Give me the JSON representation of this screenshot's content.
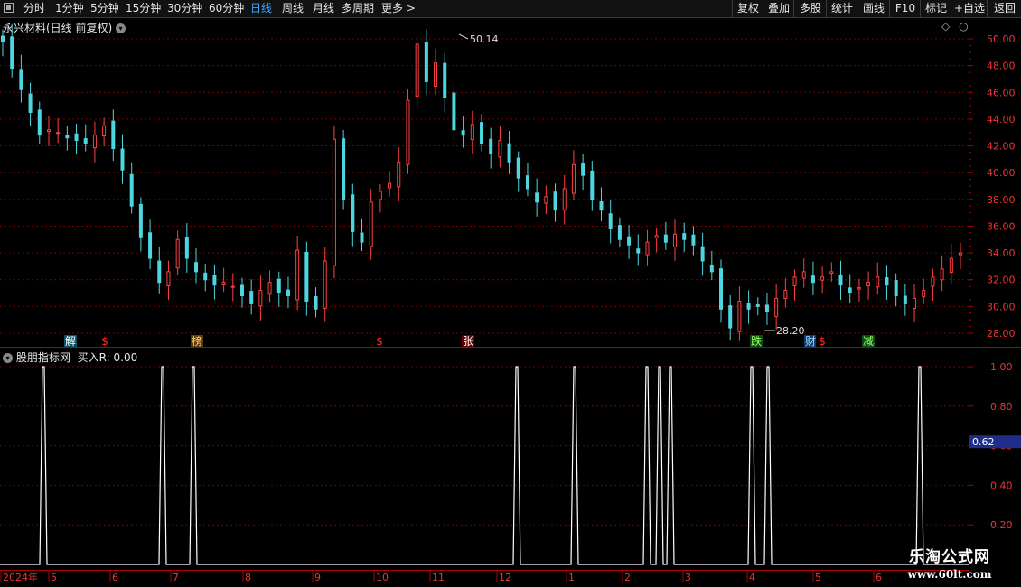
{
  "toolbar": {
    "periods": [
      "分时",
      "1分钟",
      "5分钟",
      "15分钟",
      "30分钟",
      "60分钟",
      "日线",
      "周线",
      "月线",
      "多周期",
      "更多 >"
    ],
    "active_period": "日线",
    "right_buttons": [
      "复权",
      "叠加",
      "多股",
      "统计",
      "画线",
      "F10",
      "标记",
      "+自选",
      "返回"
    ]
  },
  "main_panel": {
    "title": "永兴材料(日线 前复权)",
    "price_axis": [
      "50.00",
      "48.00",
      "46.00",
      "44.00",
      "42.00",
      "40.00",
      "38.00",
      "36.00",
      "34.00",
      "32.00",
      "30.00",
      "28.00"
    ],
    "high_label": "50.14",
    "low_label": "28.20",
    "event_markers": [
      "解",
      "$",
      "榜",
      "$",
      "张",
      "跌",
      "财",
      "$",
      "减"
    ]
  },
  "indicator_panel": {
    "title": "股朋指标网",
    "indicator_label": "买入R: 0.00",
    "axis": [
      "1.00",
      "0.80",
      "0.60",
      "0.40",
      "0.20"
    ],
    "current_value": "0.62",
    "spike_positions": [
      "2024-05-07",
      "2024-06-19",
      "2024-07-03",
      "2024-11-26",
      "2024-12-10",
      "2025-02-14",
      "2025-02-18",
      "2025-02-21",
      "2025-03-31",
      "2025-04-08",
      "2025-05-27"
    ]
  },
  "chart_data": {
    "type": "candlestick",
    "title": "永兴材料(日线 前复权)",
    "y_range": [
      27.5,
      51.0
    ],
    "y_ticks": [
      28,
      30,
      32,
      34,
      36,
      38,
      40,
      42,
      44,
      46,
      48,
      50
    ],
    "time_labels": [
      "2024年",
      "5",
      "6",
      "7",
      "8",
      "9",
      "10",
      "11",
      "12",
      "1",
      "2",
      "3",
      "4",
      "5",
      "6"
    ],
    "series": [
      {
        "name": "close",
        "values": [
          49.8,
          47.8,
          46.2,
          44.5,
          42.8,
          43.2,
          43.0,
          42.6,
          42.4,
          42.2,
          42.8,
          43.5,
          41.8,
          40.2,
          37.5,
          35.2,
          33.6,
          31.8,
          32.6,
          35.0,
          33.6,
          32.6,
          32.0,
          31.6,
          31.8,
          31.5,
          30.8,
          30.2,
          31.2,
          31.8,
          31.0,
          30.8,
          34.2,
          30.4,
          29.8,
          33.4,
          42.5,
          38.0,
          35.6,
          34.8,
          37.8,
          38.6,
          39.2,
          40.8,
          45.4,
          49.6,
          46.8,
          48.2,
          45.6,
          43.2,
          42.8,
          43.6,
          42.2,
          41.4,
          42.4,
          40.8,
          39.6,
          38.8,
          37.8,
          38.2,
          37.2,
          38.8,
          40.6,
          39.8,
          38.0,
          37.2,
          35.8,
          35.0,
          34.6,
          34.0,
          34.8,
          35.3,
          34.8,
          35.4,
          35.0,
          34.6,
          33.4,
          32.6,
          29.8,
          28.4,
          30.4,
          29.8,
          30.0,
          29.6,
          30.6,
          31.2,
          32.2,
          32.6,
          31.8,
          32.2,
          32.6,
          31.6,
          31.0,
          31.4,
          31.8,
          32.2,
          31.6,
          30.8,
          30.2,
          30.6,
          31.2,
          32.2,
          32.8,
          33.6,
          34.0
        ]
      }
    ],
    "indicator": {
      "name": "买入R",
      "current": 0.0,
      "cursor_value": 0.62,
      "y_range": [
        0,
        1.0
      ],
      "spike_value": 1.0
    }
  },
  "watermark": {
    "line1": "乐淘公式网",
    "line2": "www.60lt.com"
  },
  "colors": {
    "up": "#ff4040",
    "down": "#4dd6e0",
    "grid": "#7a0000",
    "axis": "#b00000",
    "active": "#3fa7ff",
    "indicator_line": "#ffffff",
    "value_box": "#1f2c8a"
  }
}
